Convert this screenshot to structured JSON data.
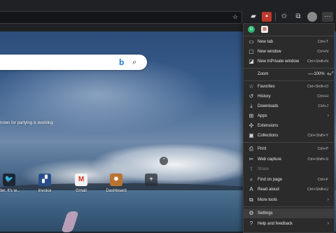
{
  "toolbar": {
    "addr_icon": "star-plus",
    "icons": [
      "collections-folder",
      "pdf-extension",
      "favorites-star",
      "collections",
      "profile",
      "more"
    ],
    "more_label": "···"
  },
  "search": {
    "bing": "b",
    "mag": "⌕"
  },
  "caption": "nown for partying is evolving",
  "quick_links": [
    {
      "label": "itter. It's w...",
      "icon": "twitter-bird"
    },
    {
      "label": "Invoice",
      "icon": "doc"
    },
    {
      "label": "Gmail",
      "icon": "M"
    },
    {
      "label": "Dashboard",
      "icon": "chart"
    },
    {
      "label": "",
      "icon": "+"
    }
  ],
  "menu": {
    "items": [
      {
        "label": "New tab",
        "shortcut": "Ctrl+T",
        "icon": "▭"
      },
      {
        "label": "New window",
        "shortcut": "Ctrl+N",
        "icon": "▢"
      },
      {
        "label": "New InPrivate window",
        "shortcut": "Ctrl+Shift+N",
        "icon": "◪"
      },
      {
        "label": "Zoom",
        "zoom_value": "100%",
        "minus": "—",
        "plus": "+",
        "full": "⤢"
      },
      {
        "label": "Favorites",
        "shortcut": "Ctrl+Shift+O",
        "icon": "☆"
      },
      {
        "label": "History",
        "shortcut": "Ctrl+H",
        "icon": "↺"
      },
      {
        "label": "Downloads",
        "shortcut": "Ctrl+J",
        "icon": "⤓"
      },
      {
        "label": "Apps",
        "icon": "⊞"
      },
      {
        "label": "Extensions",
        "icon": "✣"
      },
      {
        "label": "Collections",
        "shortcut": "Ctrl+Shift+Y",
        "icon": "▣"
      },
      {
        "label": "Print",
        "shortcut": "Ctrl+P",
        "icon": "⎙"
      },
      {
        "label": "Web capture",
        "shortcut": "Ctrl+Shift+S",
        "icon": "✂"
      },
      {
        "label": "Share",
        "icon": "⇪"
      },
      {
        "label": "Find on page",
        "shortcut": "Ctrl+F",
        "icon": "⌕"
      },
      {
        "label": "Read aloud",
        "shortcut": "Ctrl+Shift+U",
        "icon": "A"
      },
      {
        "label": "More tools",
        "icon": "⧉"
      },
      {
        "label": "Settings",
        "icon": "⚙"
      },
      {
        "label": "Help and feedback",
        "icon": "?"
      }
    ]
  },
  "colors": {
    "accent": "#1a7bd6",
    "menu_bg": "#2b2b2b"
  }
}
